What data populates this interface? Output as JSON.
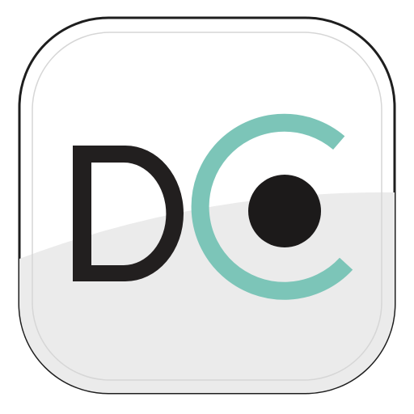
{
  "app_icon": {
    "logo_text": "DC",
    "colors": {
      "outline": "#1e1e1e",
      "tile_top": "#ffffff",
      "tile_bottom": "#ebebeb",
      "inner_border": "#d4d4d4",
      "letter_d": "#221f1f",
      "c_arc": "#7cc5b8",
      "dot": "#1c1a1a"
    },
    "icons": [
      "letter-d-glyph",
      "c-arc-glyph",
      "dot-glyph"
    ]
  }
}
